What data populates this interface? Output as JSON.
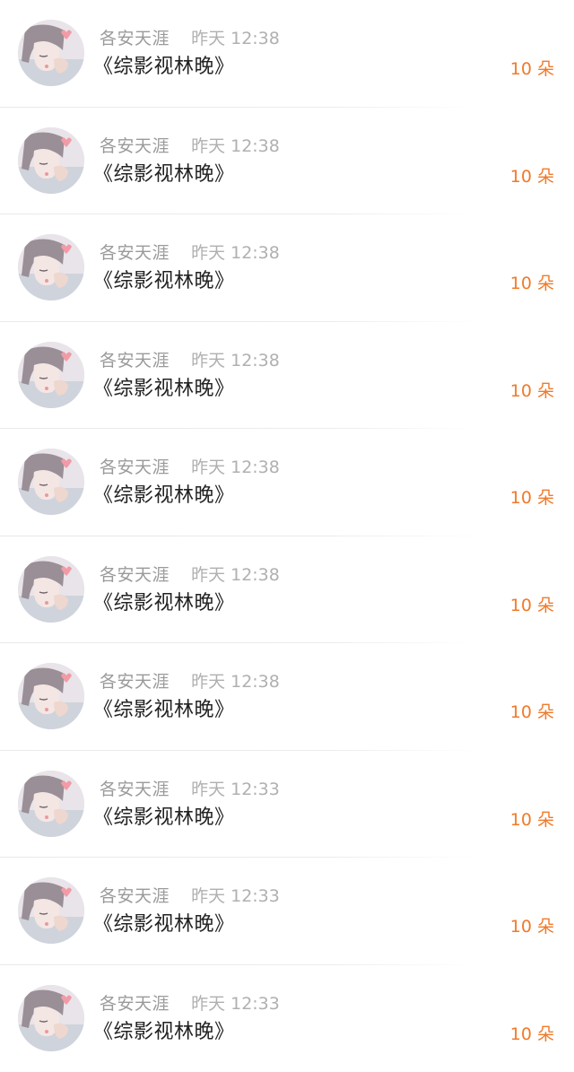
{
  "colors": {
    "background": "#ffffff",
    "name_text": "#9a9a9a",
    "time_text": "#b0b0b0",
    "title_text": "#222222",
    "amount_accent": "#f07a2a",
    "divider": "#ececec"
  },
  "avatar_icon": "avatar-illustration-icon",
  "items": [
    {
      "name": "各安天涯",
      "time": "昨天 12:38",
      "title": "《综影视林晚》",
      "amount": "10 朵"
    },
    {
      "name": "各安天涯",
      "time": "昨天 12:38",
      "title": "《综影视林晚》",
      "amount": "10 朵"
    },
    {
      "name": "各安天涯",
      "time": "昨天 12:38",
      "title": "《综影视林晚》",
      "amount": "10 朵"
    },
    {
      "name": "各安天涯",
      "time": "昨天 12:38",
      "title": "《综影视林晚》",
      "amount": "10 朵"
    },
    {
      "name": "各安天涯",
      "time": "昨天 12:38",
      "title": "《综影视林晚》",
      "amount": "10 朵"
    },
    {
      "name": "各安天涯",
      "time": "昨天 12:38",
      "title": "《综影视林晚》",
      "amount": "10 朵"
    },
    {
      "name": "各安天涯",
      "time": "昨天 12:38",
      "title": "《综影视林晚》",
      "amount": "10 朵"
    },
    {
      "name": "各安天涯",
      "time": "昨天 12:33",
      "title": "《综影视林晚》",
      "amount": "10 朵"
    },
    {
      "name": "各安天涯",
      "time": "昨天 12:33",
      "title": "《综影视林晚》",
      "amount": "10 朵"
    },
    {
      "name": "各安天涯",
      "time": "昨天 12:33",
      "title": "《综影视林晚》",
      "amount": "10 朵"
    }
  ]
}
